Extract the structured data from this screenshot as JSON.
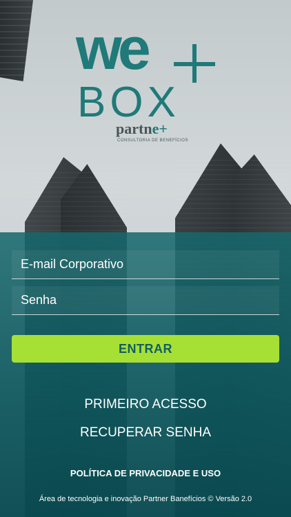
{
  "brand": {
    "we": "we",
    "box": "BOX",
    "partner": "partn",
    "partner_e": "e",
    "partner_plus": "+",
    "partner_sub": "CONSULTORIA DE BENEFÍCIOS",
    "accent_color": "#1f7a79"
  },
  "form": {
    "email_placeholder": "E-mail Corporativo",
    "password_placeholder": "Senha",
    "submit_label": "ENTRAR",
    "submit_color": "#a7e034"
  },
  "links": {
    "first_access": "PRIMEIRO ACESSO",
    "recover_password": "RECUPERAR SENHA",
    "privacy_policy": "POLÍTICA DE PRIVACIDADE E USO"
  },
  "footer": {
    "text": "Área de tecnologia e inovação Partner Banefícios © Versão 2.0"
  }
}
